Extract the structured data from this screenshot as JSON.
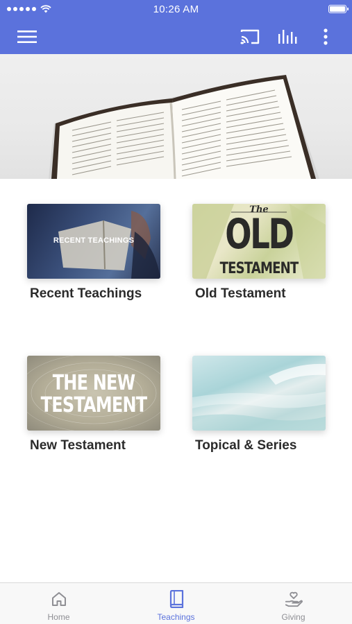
{
  "status_bar": {
    "time": "10:26 AM"
  },
  "app_bar": {
    "icons": [
      "menu-icon",
      "cast-icon",
      "equalizer-icon",
      "more-vertical-icon"
    ],
    "color": "#5b72dc"
  },
  "hero": {
    "image": "open-bible-photo"
  },
  "cards": [
    {
      "title": "Recent Teachings",
      "thumb_text": "RECENT TEACHINGS"
    },
    {
      "title": "Old Testament",
      "thumb_text_top": "The",
      "thumb_text_main": "OLD",
      "thumb_text_sub": "TESTAMENT"
    },
    {
      "title": "New Testament",
      "thumb_text_line1": "THE NEW",
      "thumb_text_line2": "TESTAMENT"
    },
    {
      "title": "Topical & Series"
    }
  ],
  "tab_bar": {
    "active_color": "#5b72dc",
    "inactive_color": "#8e8e93",
    "tabs": [
      {
        "label": "Home",
        "icon": "home-icon",
        "active": false
      },
      {
        "label": "Teachings",
        "icon": "book-icon",
        "active": true
      },
      {
        "label": "Giving",
        "icon": "giving-hand-heart-icon",
        "active": false
      }
    ]
  }
}
